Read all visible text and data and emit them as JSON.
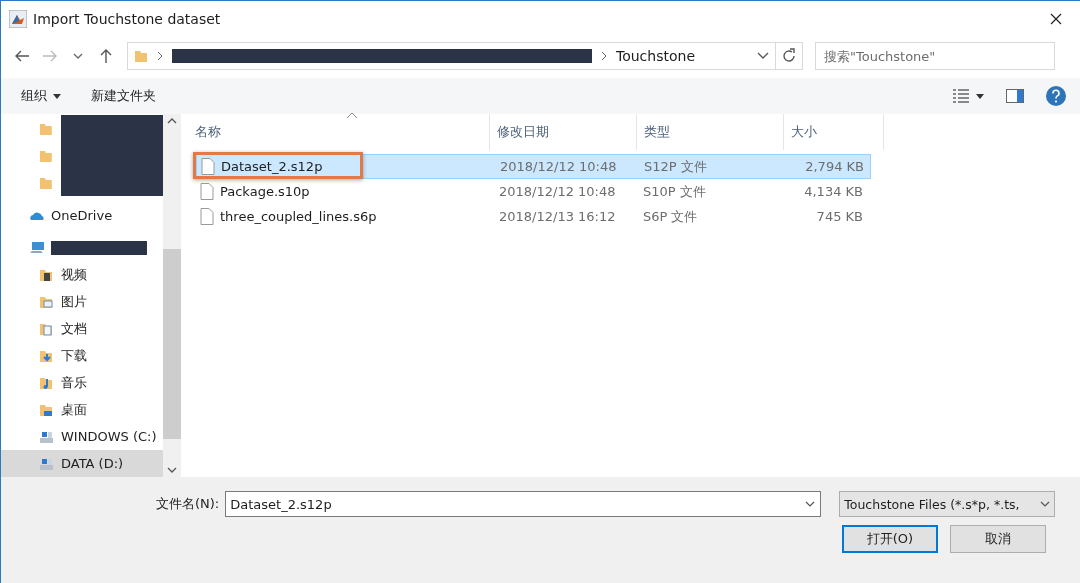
{
  "window": {
    "title": "Import Touchstone dataset"
  },
  "address_bar": {
    "segments": [
      {
        "redacted": true
      },
      {
        "label": "Touchstone",
        "redacted": false
      }
    ]
  },
  "search": {
    "placeholder": "搜索\"Touchstone\""
  },
  "toolbar": {
    "organize": "组织",
    "new_folder": "新建文件夹"
  },
  "sidebar": {
    "items": [
      {
        "kind": "folder",
        "redacted": true,
        "selected": false
      },
      {
        "kind": "folder",
        "redacted": true,
        "selected": false
      },
      {
        "kind": "folder",
        "redacted": true,
        "selected": false
      },
      {
        "kind": "cloud",
        "label": "OneDrive",
        "redacted": false,
        "selected": false
      },
      {
        "kind": "pc",
        "redacted": true,
        "selected": false,
        "children": [
          {
            "kind": "video",
            "label": "视频",
            "redacted": false,
            "selected": false
          },
          {
            "kind": "picture",
            "label": "图片",
            "redacted": false,
            "selected": false
          },
          {
            "kind": "document",
            "label": "文档",
            "redacted": false,
            "selected": false
          },
          {
            "kind": "download",
            "label": "下载",
            "redacted": false,
            "selected": false
          },
          {
            "kind": "music",
            "label": "音乐",
            "redacted": false,
            "selected": false
          },
          {
            "kind": "desktop",
            "label": "桌面",
            "redacted": false,
            "selected": false
          },
          {
            "kind": "drive",
            "label": "WINDOWS (C:)",
            "redacted": false,
            "selected": false
          },
          {
            "kind": "drive",
            "label": "DATA (D:)",
            "redacted": false,
            "selected": true
          }
        ]
      }
    ]
  },
  "table": {
    "columns": [
      "名称",
      "修改日期",
      "类型",
      "大小"
    ],
    "rows": [
      {
        "name": "Dataset_2.s12p",
        "date": "2018/12/12 10:48",
        "type": "S12P 文件",
        "size": "2,794 KB",
        "selected": true,
        "outlined": true
      },
      {
        "name": "Package.s10p",
        "date": "2018/12/12 10:48",
        "type": "S10P 文件",
        "size": "4,134 KB",
        "selected": false,
        "outlined": false
      },
      {
        "name": "three_coupled_lines.s6p",
        "date": "2018/12/13 16:12",
        "type": "S6P 文件",
        "size": "745 KB",
        "selected": false,
        "outlined": false
      }
    ]
  },
  "footer": {
    "filename_label": "文件名(N):",
    "filename_value": "Dataset_2.s12p",
    "filter": "Touchstone Files (*.s*p, *.ts,",
    "buttons": [
      {
        "label": "打开(O)",
        "default": true
      },
      {
        "label": "取消",
        "default": false
      }
    ]
  }
}
